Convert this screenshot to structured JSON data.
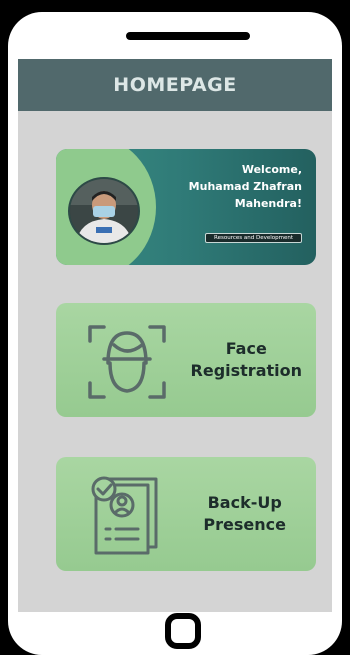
{
  "header": {
    "title": "HOMEPAGE"
  },
  "welcome": {
    "line1": "Welcome,",
    "line2": "Muhamad Zhafran",
    "line3": "Mahendra!",
    "department": "Resources and Development"
  },
  "menu": {
    "face_registration": {
      "line1": "Face",
      "line2": "Registration",
      "icon": "face-scan-icon"
    },
    "backup_presence": {
      "line1": "Back-Up",
      "line2": "Presence",
      "icon": "id-document-check-icon"
    }
  },
  "colors": {
    "appbar": "#51696c",
    "welcome_card": "#2f7a77",
    "menu_card": "#a0d09a",
    "screen_background": "#d4d4d4"
  }
}
